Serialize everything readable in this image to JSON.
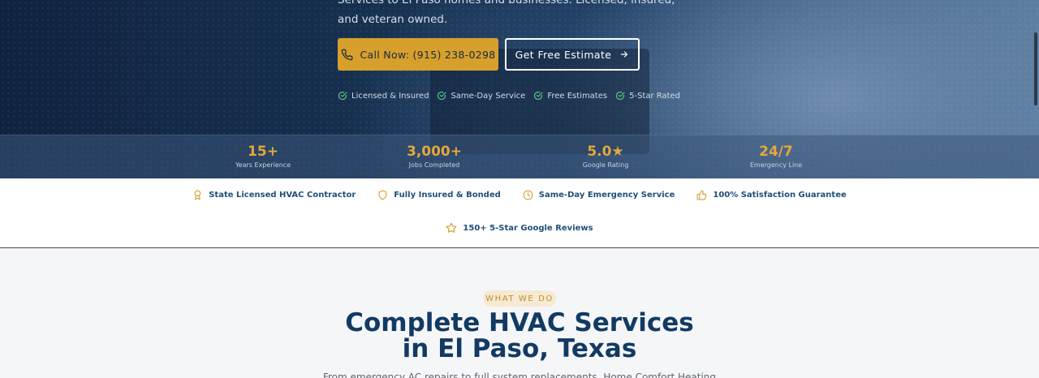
{
  "hero": {
    "subtitle": "Services to El Paso homes and businesses. Licensed, insured, and veteran owned.",
    "call_button": "Call Now: (915) 238-0298",
    "estimate_button": "Get Free Estimate",
    "checks": [
      "Licensed & Insured",
      "Same-Day Service",
      "Free Estimates",
      "5-Star Rated"
    ]
  },
  "stats": [
    {
      "value": "15+",
      "label": "Years Experience"
    },
    {
      "value": "3,000+",
      "label": "Jobs Completed"
    },
    {
      "value": "5.0★",
      "label": "Google Rating"
    },
    {
      "value": "24/7",
      "label": "Emergency Line"
    }
  ],
  "trust": {
    "items": [
      {
        "label": "State Licensed HVAC Contractor",
        "icon": "award-icon"
      },
      {
        "label": "Fully Insured & Bonded",
        "icon": "shield-icon"
      },
      {
        "label": "Same-Day Emergency Service",
        "icon": "clock-icon"
      },
      {
        "label": "100% Satisfaction Guarantee",
        "icon": "thumbs-up-icon"
      }
    ],
    "reviews": {
      "label": "150+ 5-Star Google Reviews",
      "icon": "star-icon"
    }
  },
  "services": {
    "eyebrow": "WHAT WE DO",
    "title_line1": "Complete HVAC Services",
    "title_line2": "in El Paso, Texas",
    "description": "From emergency AC repairs to full system replacements, Home Comfort Heating"
  },
  "colors": {
    "accent_gold": "#d79f2c",
    "navy": "#123a63",
    "trust_text": "#1f4f7a"
  }
}
